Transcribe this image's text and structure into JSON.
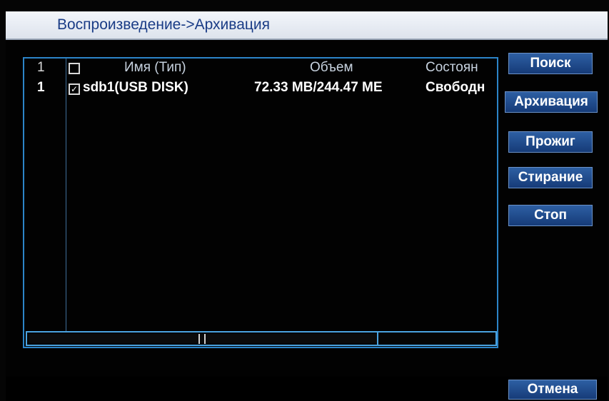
{
  "window": {
    "title": "Воспроизведение->Архивация"
  },
  "list": {
    "header": {
      "index": "1",
      "name": "Имя (Тип)",
      "size": "Объем",
      "status": "Состоян"
    },
    "rows": [
      {
        "index": "1",
        "name": "sdb1(USB DISK)",
        "size": "72.33 MB/244.47 ME",
        "status": "Свободн",
        "checked": true
      }
    ]
  },
  "buttons": {
    "search": "Поиск",
    "archive": "Архивация",
    "burn": "Прожиг",
    "erase": "Стирание",
    "stop": "Стоп",
    "cancel": "Отмена"
  },
  "colors": {
    "accent": "#2c84c8",
    "button": "#1f4c8f",
    "title_text": "#1a3c86"
  }
}
